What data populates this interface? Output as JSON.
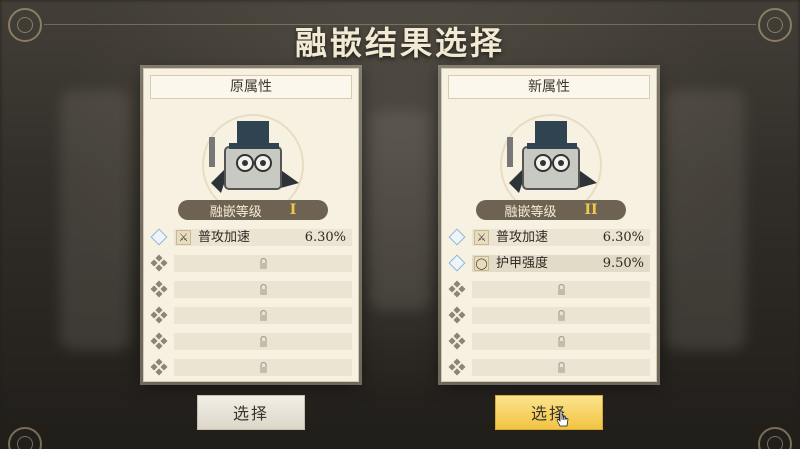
{
  "title": "融嵌结果选择",
  "cards": [
    {
      "header": "原属性",
      "level_label": "融嵌等级",
      "level_value": "I",
      "rows": [
        {
          "locked": false,
          "icon": "sword-icon",
          "name": "普攻加速",
          "value": "6.30%"
        },
        {
          "locked": true
        },
        {
          "locked": true
        },
        {
          "locked": true
        },
        {
          "locked": true
        },
        {
          "locked": true
        }
      ],
      "button": "选择"
    },
    {
      "header": "新属性",
      "level_label": "融嵌等级",
      "level_value": "II",
      "rows": [
        {
          "locked": false,
          "icon": "sword-icon",
          "name": "普攻加速",
          "value": "6.30%"
        },
        {
          "locked": false,
          "icon": "ring-icon",
          "name": "护甲强度",
          "value": "9.50%"
        },
        {
          "locked": true
        },
        {
          "locked": true
        },
        {
          "locked": true
        },
        {
          "locked": true
        }
      ],
      "button": "选择"
    }
  ],
  "colors": {
    "card_bg": "#f7f1e2",
    "level_bar": "#6e6352",
    "level_value": "#f3c94a",
    "button_highlight": "#f2c443"
  }
}
